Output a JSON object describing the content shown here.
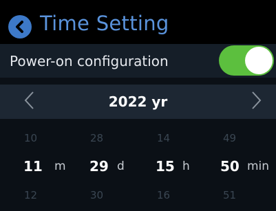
{
  "header": {
    "title": "Time Setting",
    "back_icon": "chevron-left-icon"
  },
  "power_on": {
    "label": "Power-on configuration",
    "toggle_state": "on",
    "toggle_color": "#5cbf3e"
  },
  "year": {
    "label": "2022 yr",
    "prev_icon": "chevron-left-icon",
    "next_icon": "chevron-right-icon"
  },
  "picker": {
    "month": {
      "prev": "10",
      "value": "11",
      "next": "12",
      "unit": "m"
    },
    "day": {
      "prev": "28",
      "value": "29",
      "next": "30",
      "unit": "d"
    },
    "hour": {
      "prev": "14",
      "value": "15",
      "next": "16",
      "unit": "h"
    },
    "minute": {
      "prev": "49",
      "value": "50",
      "next": "51",
      "unit": "min"
    }
  },
  "colors": {
    "accent": "#5a93dc",
    "back_button": "#3d79c8",
    "background": "#0b1016",
    "row_background": "#151e28",
    "year_bar_background": "#1d2733"
  }
}
